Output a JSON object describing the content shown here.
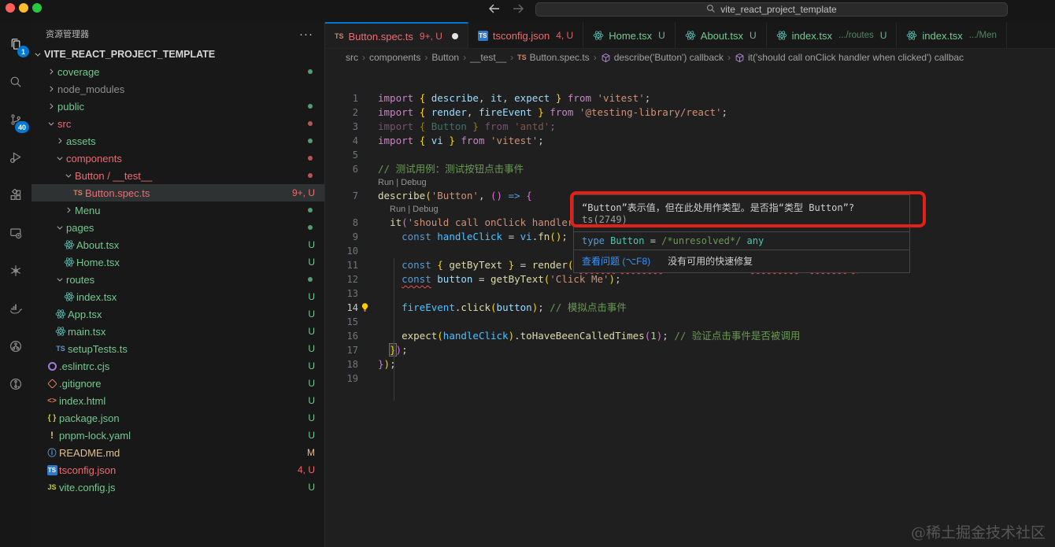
{
  "window": {
    "search_value": "vite_react_project_template",
    "controls": [
      "close",
      "minimize",
      "zoom"
    ]
  },
  "activity_bar": {
    "items": [
      {
        "name": "explorer",
        "icon": "files-icon",
        "badge": "1",
        "active": true
      },
      {
        "name": "search",
        "icon": "search-icon"
      },
      {
        "name": "source-control",
        "icon": "source-control-icon",
        "badge": "40"
      },
      {
        "name": "run-debug",
        "icon": "run-debug-icon"
      },
      {
        "name": "extensions",
        "icon": "extensions-icon"
      },
      {
        "name": "remote-explorer",
        "icon": "remote-icon"
      },
      {
        "name": "openai",
        "icon": "openai-icon"
      },
      {
        "name": "docker",
        "icon": "docker-icon"
      },
      {
        "name": "git-graph",
        "icon": "git-graph-icon"
      },
      {
        "name": "gitlens",
        "icon": "gitlens-icon"
      }
    ]
  },
  "sidebar": {
    "title": "资源管理器",
    "actions_label": "···",
    "root": "VITE_REACT_PROJECT_TEMPLATE",
    "items": [
      {
        "label": "coverage",
        "level": 1,
        "kind": "folder",
        "expanded": false,
        "color": "green",
        "dot": "green"
      },
      {
        "label": "node_modules",
        "level": 1,
        "kind": "folder",
        "expanded": false,
        "color": "gray"
      },
      {
        "label": "public",
        "level": 1,
        "kind": "folder",
        "expanded": false,
        "color": "green",
        "dot": "green"
      },
      {
        "label": "src",
        "level": 1,
        "kind": "folder",
        "expanded": true,
        "color": "red",
        "dot": "red"
      },
      {
        "label": "assets",
        "level": 2,
        "kind": "folder",
        "expanded": false,
        "color": "green",
        "dot": "green"
      },
      {
        "label": "components",
        "level": 2,
        "kind": "folder",
        "expanded": true,
        "color": "red",
        "dot": "red"
      },
      {
        "label": "Button / __test__",
        "level": 3,
        "kind": "folder",
        "expanded": true,
        "color": "red",
        "dot": "red"
      },
      {
        "label": "Button.spec.ts",
        "level": 4,
        "kind": "file",
        "icon": "ts-orange-icon",
        "color": "red",
        "badge": "9+, U",
        "selected": true
      },
      {
        "label": "Menu",
        "level": 3,
        "kind": "folder",
        "expanded": false,
        "color": "green",
        "dot": "green"
      },
      {
        "label": "pages",
        "level": 2,
        "kind": "folder",
        "expanded": true,
        "color": "green",
        "dot": "green"
      },
      {
        "label": "About.tsx",
        "level": 3,
        "kind": "file",
        "icon": "react-icon",
        "color": "green",
        "badge": "U"
      },
      {
        "label": "Home.tsx",
        "level": 3,
        "kind": "file",
        "icon": "react-icon",
        "color": "green",
        "badge": "U"
      },
      {
        "label": "routes",
        "level": 2,
        "kind": "folder",
        "expanded": true,
        "color": "green",
        "dot": "green"
      },
      {
        "label": "index.tsx",
        "level": 3,
        "kind": "file",
        "icon": "react-icon",
        "color": "green",
        "badge": "U"
      },
      {
        "label": "App.tsx",
        "level": 2,
        "kind": "file",
        "icon": "react-icon",
        "color": "green",
        "badge": "U"
      },
      {
        "label": "main.tsx",
        "level": 2,
        "kind": "file",
        "icon": "react-icon",
        "color": "green",
        "badge": "U"
      },
      {
        "label": "setupTests.ts",
        "level": 2,
        "kind": "file",
        "icon": "ts-blue-icon",
        "color": "green",
        "badge": "U"
      },
      {
        "label": ".eslintrc.cjs",
        "level": 1,
        "kind": "file",
        "icon": "eslint-icon",
        "color": "green",
        "badge": "U"
      },
      {
        "label": ".gitignore",
        "level": 1,
        "kind": "file",
        "icon": "git-icon",
        "color": "green",
        "badge": "U"
      },
      {
        "label": "index.html",
        "level": 1,
        "kind": "file",
        "icon": "html-icon",
        "color": "green",
        "badge": "U"
      },
      {
        "label": "package.json",
        "level": 1,
        "kind": "file",
        "icon": "json-icon",
        "color": "green",
        "badge": "U"
      },
      {
        "label": "pnpm-lock.yaml",
        "level": 1,
        "kind": "file",
        "icon": "warn-icon",
        "color": "green",
        "badge": "U"
      },
      {
        "label": "README.md",
        "level": 1,
        "kind": "file",
        "icon": "info-icon",
        "color": "yellow",
        "badge": "M"
      },
      {
        "label": "tsconfig.json",
        "level": 1,
        "kind": "file",
        "icon": "ts-badge-icon",
        "color": "red",
        "badge": "4, U"
      },
      {
        "label": "vite.config.js",
        "level": 1,
        "kind": "file",
        "icon": "js-icon",
        "color": "green",
        "badge": "U"
      }
    ]
  },
  "tabs": [
    {
      "icon": "ts-orange-icon",
      "label": "Button.spec.ts",
      "badge": "9+, U",
      "color": "red",
      "dirty": true,
      "active": true
    },
    {
      "icon": "ts-badge-icon",
      "label": "tsconfig.json",
      "badge": "4, U",
      "color": "red"
    },
    {
      "icon": "react-icon",
      "label": "Home.tsx",
      "badge": "U",
      "color": "green"
    },
    {
      "icon": "react-icon",
      "label": "About.tsx",
      "badge": "U",
      "color": "green"
    },
    {
      "icon": "react-icon",
      "label": "index.tsx",
      "desc": ".../routes",
      "badge": "U",
      "color": "green"
    },
    {
      "icon": "react-icon",
      "label": "index.tsx",
      "desc": ".../Men",
      "color": "green"
    }
  ],
  "breadcrumb": [
    {
      "label": "src"
    },
    {
      "label": "components"
    },
    {
      "label": "Button"
    },
    {
      "label": "__test__"
    },
    {
      "icon": "ts-orange-icon",
      "label": "Button.spec.ts"
    },
    {
      "icon": "symbol-cube-icon",
      "label": "describe('Button') callback"
    },
    {
      "icon": "symbol-cube-icon",
      "label": "it('should call onClick handler when clicked') callbac"
    }
  ],
  "editor": {
    "codelens_label": "Run | Debug",
    "lines": [
      {
        "n": 1,
        "tokens": [
          [
            "kw",
            "import "
          ],
          [
            "b1",
            "{ "
          ],
          [
            "id",
            "describe"
          ],
          [
            "pl",
            ", "
          ],
          [
            "id",
            "it"
          ],
          [
            "pl",
            ", "
          ],
          [
            "id",
            "expect"
          ],
          [
            "b1",
            " }"
          ],
          [
            "kw",
            " from "
          ],
          [
            "str",
            "'vitest'"
          ],
          [
            "pl",
            ";"
          ]
        ]
      },
      {
        "n": 2,
        "tokens": [
          [
            "kw",
            "import "
          ],
          [
            "b1",
            "{ "
          ],
          [
            "id",
            "render"
          ],
          [
            "pl",
            ", "
          ],
          [
            "id",
            "fireEvent"
          ],
          [
            "b1",
            " }"
          ],
          [
            "kw",
            " from "
          ],
          [
            "str",
            "'@testing-library/react'"
          ],
          [
            "pl",
            ";"
          ]
        ]
      },
      {
        "n": 3,
        "dim": true,
        "tokens": [
          [
            "kw",
            "import "
          ],
          [
            "b1",
            "{ "
          ],
          [
            "type",
            "Button"
          ],
          [
            "b1",
            " }"
          ],
          [
            "kw",
            " from "
          ],
          [
            "str",
            "'antd'"
          ],
          [
            "pl",
            ";"
          ]
        ]
      },
      {
        "n": 4,
        "tokens": [
          [
            "kw",
            "import "
          ],
          [
            "b1",
            "{ "
          ],
          [
            "id",
            "vi"
          ],
          [
            "b1",
            " }"
          ],
          [
            "kw",
            " from "
          ],
          [
            "str",
            "'vitest'"
          ],
          [
            "pl",
            ";"
          ]
        ]
      },
      {
        "n": 5,
        "tokens": []
      },
      {
        "n": 6,
        "tokens": [
          [
            "cmt",
            "// 测试用例：测试按钮点击事件"
          ]
        ]
      },
      {
        "codelens": true,
        "indent": 0
      },
      {
        "n": 7,
        "tokens": [
          [
            "fn",
            "describe"
          ],
          [
            "b1",
            "("
          ],
          [
            "str",
            "'Button'"
          ],
          [
            "pl",
            ", "
          ],
          [
            "b2",
            "()"
          ],
          [
            "kw2",
            " => "
          ],
          [
            "b2",
            "{"
          ]
        ]
      },
      {
        "codelens": true,
        "indent": 2
      },
      {
        "n": 8,
        "tokens": [
          [
            "pl",
            "  "
          ],
          [
            "fn",
            "it"
          ],
          [
            "b2",
            "("
          ],
          [
            "str",
            "'should call onClick handler when clicked'"
          ],
          [
            "pl",
            ", "
          ],
          [
            "b3",
            "()"
          ],
          [
            "kw2",
            " => "
          ],
          [
            "b3",
            "{"
          ]
        ]
      },
      {
        "n": 9,
        "tokens": [
          [
            "pl",
            "    "
          ],
          [
            "const",
            "const "
          ],
          [
            "var",
            "handleClick"
          ],
          [
            "pl",
            " = "
          ],
          [
            "var",
            "vi"
          ],
          [
            "pl",
            "."
          ],
          [
            "fn",
            "fn"
          ],
          [
            "b1",
            "()"
          ],
          [
            "pl",
            "; "
          ],
          [
            "cmt",
            "//"
          ]
        ]
      },
      {
        "n": 10,
        "tokens": []
      },
      {
        "n": 11,
        "tokens": [
          [
            "pl",
            "    "
          ],
          [
            "const",
            "const "
          ],
          [
            "b1",
            "{ "
          ],
          [
            "fn",
            "getByText"
          ],
          [
            "b1",
            " }"
          ],
          [
            "pl",
            " = "
          ],
          [
            "fn",
            "render"
          ],
          [
            "b1",
            "("
          ],
          [
            "pl",
            "<"
          ],
          [
            "type sq",
            "Button"
          ],
          [
            "pl",
            " "
          ],
          [
            "id sq",
            "onClick"
          ],
          [
            "pl",
            "="
          ],
          [
            "b3",
            "{"
          ],
          [
            "var",
            "handleClick"
          ],
          [
            "b3",
            "}"
          ],
          [
            "pl",
            ">"
          ],
          [
            "pl sq",
            "Click Me"
          ],
          [
            "pl",
            "</"
          ],
          [
            "type sq",
            "Button"
          ],
          [
            "pl",
            ">"
          ],
          [
            "b1 sq",
            ")"
          ],
          [
            "pl",
            ";"
          ]
        ]
      },
      {
        "n": 12,
        "tokens": [
          [
            "pl",
            "    "
          ],
          [
            "const sq",
            "const"
          ],
          [
            "pl",
            " "
          ],
          [
            "id",
            "button"
          ],
          [
            "pl",
            " = "
          ],
          [
            "fn",
            "getByText"
          ],
          [
            "b1",
            "("
          ],
          [
            "str",
            "'Click Me'"
          ],
          [
            "b1",
            ")"
          ],
          [
            "pl",
            ";"
          ]
        ]
      },
      {
        "n": 13,
        "tokens": []
      },
      {
        "n": 14,
        "cursor": true,
        "bulb": true,
        "tokens": [
          [
            "pl",
            "    "
          ],
          [
            "var",
            "fireEvent"
          ],
          [
            "pl",
            "."
          ],
          [
            "fn",
            "click"
          ],
          [
            "b1",
            "("
          ],
          [
            "id",
            "button"
          ],
          [
            "b1",
            ")"
          ],
          [
            "pl",
            "; "
          ],
          [
            "cmt",
            "// 模拟点击事件"
          ]
        ]
      },
      {
        "n": 15,
        "tokens": []
      },
      {
        "n": 16,
        "tokens": [
          [
            "pl",
            "    "
          ],
          [
            "fn",
            "expect"
          ],
          [
            "b1",
            "("
          ],
          [
            "var",
            "handleClick"
          ],
          [
            "b1",
            ")"
          ],
          [
            "pl",
            "."
          ],
          [
            "fn",
            "toHaveBeenCalledTimes"
          ],
          [
            "b2",
            "("
          ],
          [
            "num",
            "1"
          ],
          [
            "b2",
            ")"
          ],
          [
            "pl",
            "; "
          ],
          [
            "cmt",
            "// 验证点击事件是否被调用"
          ]
        ]
      },
      {
        "n": 17,
        "tokens": [
          [
            "pl",
            "  "
          ],
          [
            "b1 bm",
            "}"
          ],
          [
            "b2",
            ")"
          ],
          [
            "pl",
            ";"
          ]
        ]
      },
      {
        "n": 18,
        "tokens": [
          [
            "b2",
            "}"
          ],
          [
            "b1",
            ")"
          ],
          [
            "pl",
            ";"
          ]
        ]
      },
      {
        "n": 19,
        "tokens": []
      }
    ]
  },
  "tooltip": {
    "message": "“Button”表示值，但在此处用作类型。是否指“类型 Button”?",
    "code": "ts(2749)",
    "type_line": [
      [
        "kw2",
        "type "
      ],
      [
        "type",
        "Button"
      ],
      [
        "pl",
        " = "
      ],
      [
        "cmt",
        "/*unresolved*/ "
      ],
      [
        "type",
        "any"
      ]
    ],
    "link": "查看问题 (⌥F8)",
    "no_fix": "没有可用的快速修复"
  },
  "colors": {
    "accent_blue": "#0078d4",
    "git_untracked_green": "#73c991",
    "error_red": "#ee6b70",
    "git_modified_yellow": "#e2c08d",
    "annotation_red": "#e22016",
    "light_red": "#ff5f57",
    "light_yellow": "#febc2e",
    "light_green": "#28c840"
  },
  "watermark": "@稀土掘金技术社区"
}
